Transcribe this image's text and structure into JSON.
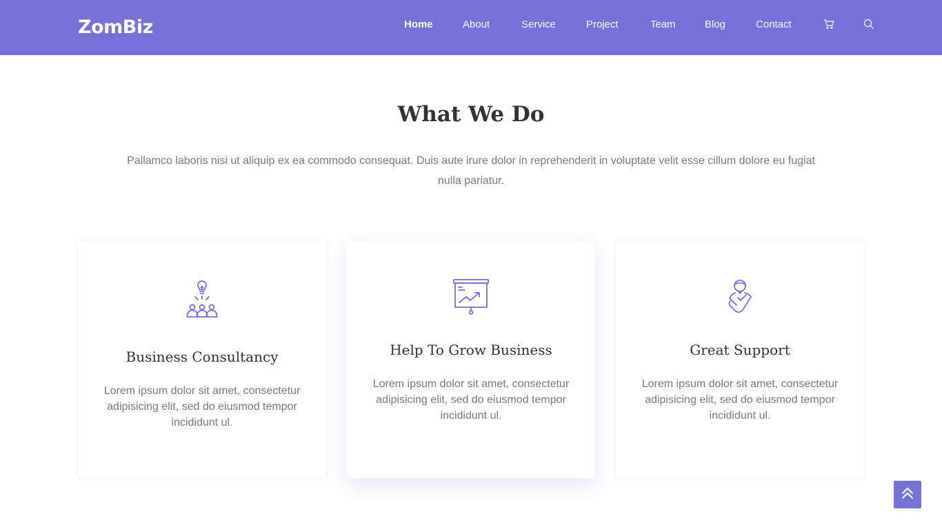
{
  "brand": {
    "name": "ZomBiz",
    "accent_color": "#7571d8"
  },
  "nav": {
    "items": [
      {
        "label": "Home",
        "active": true
      },
      {
        "label": "About"
      },
      {
        "label": "Service"
      },
      {
        "label": "Project"
      },
      {
        "label": "Team"
      },
      {
        "label": "Blog"
      },
      {
        "label": "Contact"
      }
    ],
    "icons": [
      "cart-icon",
      "search-icon"
    ]
  },
  "section": {
    "title": "What We Do",
    "description": "Pallamco laboris nisi ut aliquip ex ea commodo consequat. Duis aute irure dolor in reprehenderit in voluptate velit esse cillum dolore eu fugiat nulla pariatur."
  },
  "cards": [
    {
      "icon": "team-idea-icon",
      "title": "Business Consultancy",
      "text": "Lorem ipsum dolor sit amet, consectetur adipisicing elit, sed do eiusmod tempor incididunt ul."
    },
    {
      "icon": "presentation-chart-icon",
      "title": "Help To Grow Business",
      "text": "Lorem ipsum dolor sit amet, consectetur adipisicing elit, sed do eiusmod tempor incididunt ul."
    },
    {
      "icon": "support-handshake-icon",
      "title": "Great Support",
      "text": "Lorem ipsum dolor sit amet, consectetur adipisicing elit, sed do eiusmod tempor incididunt ul."
    }
  ],
  "back_to_top": {
    "icon": "double-chevron-up-icon"
  }
}
